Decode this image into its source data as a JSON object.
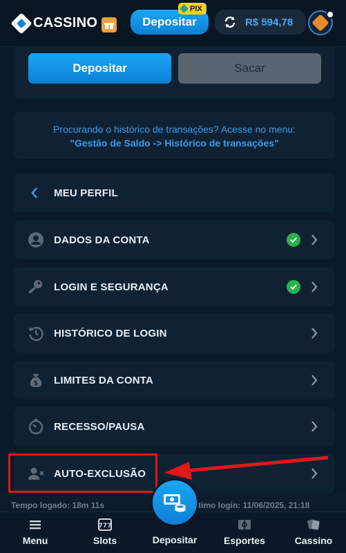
{
  "header": {
    "logo_text": "CASSINO",
    "deposit_label": "Depositar",
    "pix_badge": "PIX",
    "balance": "R$ 594,78"
  },
  "actions": {
    "deposit_label": "Depositar",
    "withdraw_label": "Sacar"
  },
  "info": {
    "line1": "Procurando o histórico de transações? Acesse no menu:",
    "line2": "\"Gestão de Saldo -> Histórico de transações\""
  },
  "menu": {
    "title": "MEU PERFIL",
    "items": [
      {
        "label": "DADOS DA CONTA",
        "verified": true,
        "icon": "user-circle-icon"
      },
      {
        "label": "LOGIN E SEGURANÇA",
        "verified": true,
        "icon": "key-icon"
      },
      {
        "label": "HISTÓRICO DE LOGIN",
        "verified": false,
        "icon": "history-icon"
      },
      {
        "label": "LIMITES DA CONTA",
        "verified": false,
        "icon": "money-bag-icon"
      },
      {
        "label": "RECESSO/PAUSA",
        "verified": false,
        "icon": "timer-icon"
      },
      {
        "label": "AUTO-EXCLUSÃO",
        "verified": false,
        "icon": "user-remove-icon"
      }
    ]
  },
  "status": {
    "left": "Tempo logado: 18m 11s",
    "right": "Último login: 11/06/2025, 21:18"
  },
  "bottom_nav": {
    "menu": "Menu",
    "slots": "Slots",
    "deposit": "Depositar",
    "sports": "Esportes",
    "casino": "Cassino"
  },
  "colors": {
    "accent": "#1aa6f5",
    "background": "#0b1a2a",
    "card": "#0f2234",
    "verified": "#2bb24c",
    "highlight": "#e01818"
  }
}
